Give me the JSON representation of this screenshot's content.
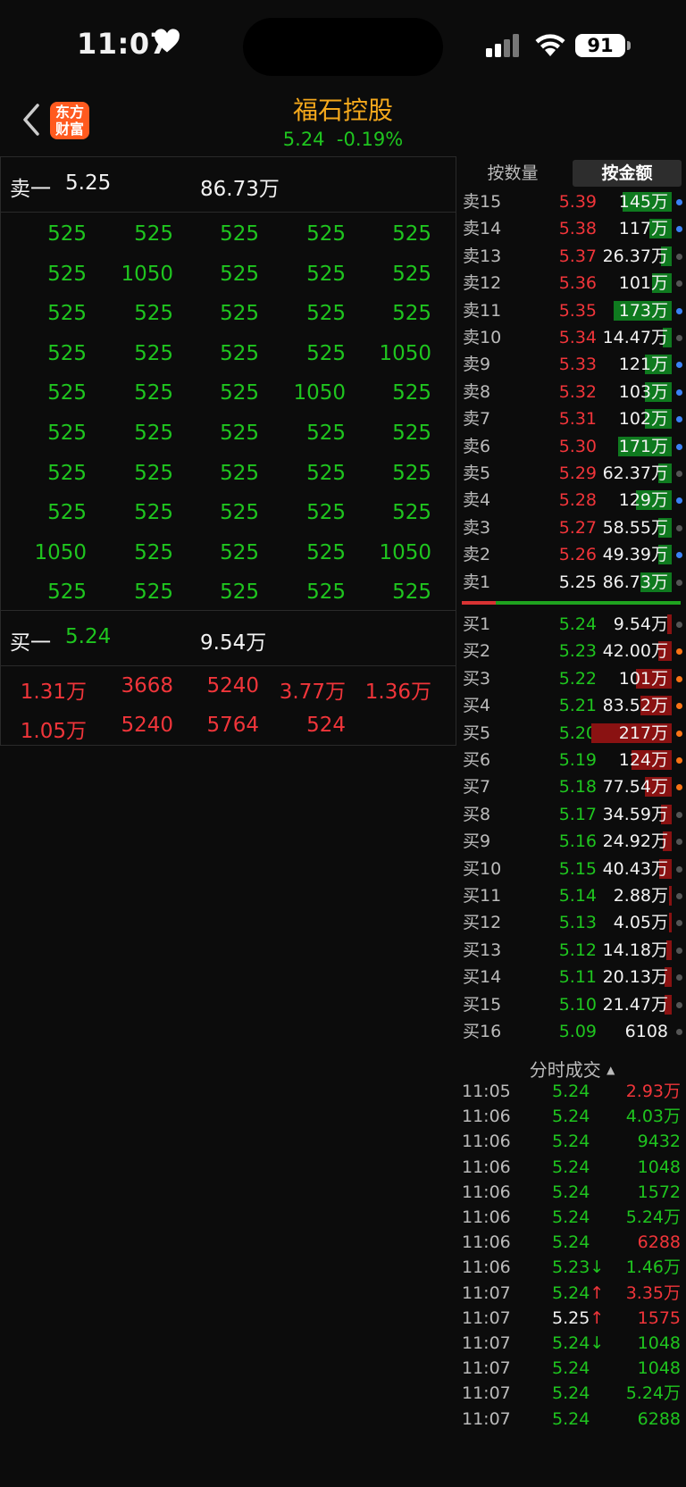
{
  "status_bar": {
    "time": "11:07",
    "battery": "91"
  },
  "header": {
    "stock_name": "福石控股",
    "price": "5.24",
    "change_pct": "-0.19%",
    "logo_line1": "东方",
    "logo_line2": "财富"
  },
  "colors": {
    "up": "#f0353a",
    "down": "#1fc51f",
    "title": "#f4a81c",
    "background": "#0c0c0c"
  },
  "icons": [
    "heart-icon",
    "cellular-signal-icon",
    "wifi-icon",
    "battery-icon",
    "back-chevron-icon",
    "app-logo",
    "sort-up-icon"
  ],
  "sell_queue": {
    "label": "卖一",
    "price": "5.25",
    "volume": "86.73万",
    "orders": [
      [
        "525",
        "525",
        "525",
        "525",
        "525"
      ],
      [
        "525",
        "1050",
        "525",
        "525",
        "525"
      ],
      [
        "525",
        "525",
        "525",
        "525",
        "525"
      ],
      [
        "525",
        "525",
        "525",
        "525",
        "1050"
      ],
      [
        "525",
        "525",
        "525",
        "1050",
        "525"
      ],
      [
        "525",
        "525",
        "525",
        "525",
        "525"
      ],
      [
        "525",
        "525",
        "525",
        "525",
        "525"
      ],
      [
        "525",
        "525",
        "525",
        "525",
        "525"
      ],
      [
        "1050",
        "525",
        "525",
        "525",
        "1050"
      ],
      [
        "525",
        "525",
        "525",
        "525",
        "525"
      ]
    ]
  },
  "buy_queue": {
    "label": "买一",
    "price": "5.24",
    "volume": "9.54万",
    "orders": [
      [
        "1.31万",
        "3668",
        "5240",
        "3.77万",
        "1.36万"
      ],
      [
        "1.05万",
        "5240",
        "5764",
        "524",
        ""
      ]
    ]
  },
  "tabs": {
    "by_quantity": "按数量",
    "by_amount": "按金额",
    "selected": "by_amount"
  },
  "asks": [
    {
      "label": "卖15",
      "price": "5.39",
      "volume": "145万",
      "bar": 0.55,
      "dot": "blue"
    },
    {
      "label": "卖14",
      "price": "5.38",
      "volume": "117万",
      "bar": 0.25,
      "dot": "blue"
    },
    {
      "label": "卖13",
      "price": "5.37",
      "volume": "26.37万",
      "bar": 0.12,
      "dot": "gray"
    },
    {
      "label": "卖12",
      "price": "5.36",
      "volume": "101万",
      "bar": 0.22,
      "dot": "gray"
    },
    {
      "label": "卖11",
      "price": "5.35",
      "volume": "173万",
      "bar": 0.65,
      "dot": "blue"
    },
    {
      "label": "卖10",
      "price": "5.34",
      "volume": "14.47万",
      "bar": 0.1,
      "dot": "gray"
    },
    {
      "label": "卖9",
      "price": "5.33",
      "volume": "121万",
      "bar": 0.3,
      "dot": "blue"
    },
    {
      "label": "卖8",
      "price": "5.32",
      "volume": "103万",
      "bar": 0.3,
      "dot": "blue"
    },
    {
      "label": "卖7",
      "price": "5.31",
      "volume": "102万",
      "bar": 0.3,
      "dot": "blue"
    },
    {
      "label": "卖6",
      "price": "5.30",
      "volume": "171万",
      "bar": 0.6,
      "dot": "blue"
    },
    {
      "label": "卖5",
      "price": "5.29",
      "volume": "62.37万",
      "bar": 0.15,
      "dot": "gray"
    },
    {
      "label": "卖4",
      "price": "5.28",
      "volume": "129万",
      "bar": 0.4,
      "dot": "blue"
    },
    {
      "label": "卖3",
      "price": "5.27",
      "volume": "58.55万",
      "bar": 0.15,
      "dot": "gray"
    },
    {
      "label": "卖2",
      "price": "5.26",
      "volume": "49.39万",
      "bar": 0.15,
      "dot": "blue"
    },
    {
      "label": "卖1",
      "price": "5.25",
      "volume": "86.73万",
      "bar": 0.35,
      "dot": "gray"
    }
  ],
  "bids": [
    {
      "label": "买1",
      "price": "5.24",
      "volume": "9.54万",
      "bar": 0.05,
      "dot": "gray"
    },
    {
      "label": "买2",
      "price": "5.23",
      "volume": "42.00万",
      "bar": 0.15,
      "dot": "orange"
    },
    {
      "label": "买3",
      "price": "5.22",
      "volume": "101万",
      "bar": 0.4,
      "dot": "orange"
    },
    {
      "label": "买4",
      "price": "5.21",
      "volume": "83.52万",
      "bar": 0.35,
      "dot": "orange"
    },
    {
      "label": "买5",
      "price": "5.20",
      "volume": "217万",
      "bar": 0.9,
      "dot": "orange"
    },
    {
      "label": "买6",
      "price": "5.19",
      "volume": "124万",
      "bar": 0.45,
      "dot": "orange"
    },
    {
      "label": "买7",
      "price": "5.18",
      "volume": "77.54万",
      "bar": 0.3,
      "dot": "orange"
    },
    {
      "label": "买8",
      "price": "5.17",
      "volume": "34.59万",
      "bar": 0.12,
      "dot": "gray"
    },
    {
      "label": "买9",
      "price": "5.16",
      "volume": "24.92万",
      "bar": 0.1,
      "dot": "gray"
    },
    {
      "label": "买10",
      "price": "5.15",
      "volume": "40.43万",
      "bar": 0.14,
      "dot": "gray"
    },
    {
      "label": "买11",
      "price": "5.14",
      "volume": "2.88万",
      "bar": 0.03,
      "dot": "gray"
    },
    {
      "label": "买12",
      "price": "5.13",
      "volume": "4.05万",
      "bar": 0.03,
      "dot": "gray"
    },
    {
      "label": "买13",
      "price": "5.12",
      "volume": "14.18万",
      "bar": 0.06,
      "dot": "gray"
    },
    {
      "label": "买14",
      "price": "5.11",
      "volume": "20.13万",
      "bar": 0.08,
      "dot": "gray"
    },
    {
      "label": "买15",
      "price": "5.10",
      "volume": "21.47万",
      "bar": 0.08,
      "dot": "gray"
    },
    {
      "label": "买16",
      "price": "5.09",
      "volume": "6108",
      "bar": 0,
      "dot": "gray"
    }
  ],
  "ticks": {
    "title": "分时成交",
    "rows": [
      {
        "time": "11:05",
        "price": "5.24",
        "arrow": "",
        "volume": "2.93万",
        "pc": "green",
        "vc": "red"
      },
      {
        "time": "11:06",
        "price": "5.24",
        "arrow": "",
        "volume": "4.03万",
        "pc": "green",
        "vc": "green"
      },
      {
        "time": "11:06",
        "price": "5.24",
        "arrow": "",
        "volume": "9432",
        "pc": "green",
        "vc": "green"
      },
      {
        "time": "11:06",
        "price": "5.24",
        "arrow": "",
        "volume": "1048",
        "pc": "green",
        "vc": "green"
      },
      {
        "time": "11:06",
        "price": "5.24",
        "arrow": "",
        "volume": "1572",
        "pc": "green",
        "vc": "green"
      },
      {
        "time": "11:06",
        "price": "5.24",
        "arrow": "",
        "volume": "5.24万",
        "pc": "green",
        "vc": "green"
      },
      {
        "time": "11:06",
        "price": "5.24",
        "arrow": "",
        "volume": "6288",
        "pc": "green",
        "vc": "red"
      },
      {
        "time": "11:06",
        "price": "5.23",
        "arrow": "↓",
        "volume": "1.46万",
        "pc": "green",
        "vc": "green"
      },
      {
        "time": "11:07",
        "price": "5.24",
        "arrow": "↑",
        "volume": "3.35万",
        "pc": "green",
        "vc": "red"
      },
      {
        "time": "11:07",
        "price": "5.25",
        "arrow": "↑",
        "volume": "1575",
        "pc": "white",
        "vc": "red"
      },
      {
        "time": "11:07",
        "price": "5.24",
        "arrow": "↓",
        "volume": "1048",
        "pc": "green",
        "vc": "green"
      },
      {
        "time": "11:07",
        "price": "5.24",
        "arrow": "",
        "volume": "1048",
        "pc": "green",
        "vc": "green"
      },
      {
        "time": "11:07",
        "price": "5.24",
        "arrow": "",
        "volume": "5.24万",
        "pc": "green",
        "vc": "green"
      },
      {
        "time": "11:07",
        "price": "5.24",
        "arrow": "",
        "volume": "6288",
        "pc": "green",
        "vc": "green"
      }
    ]
  }
}
